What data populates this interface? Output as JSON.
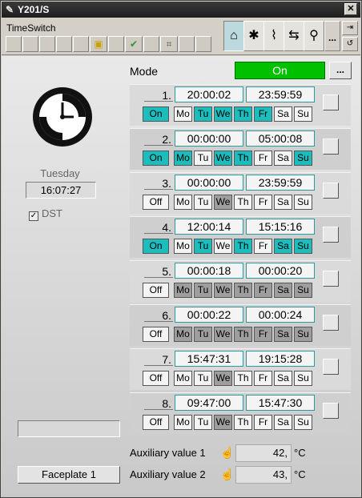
{
  "window": {
    "title": "Y201/S",
    "close_glyph": "✕"
  },
  "toolbar": {
    "app_name": "TimeSwitch",
    "icons": [
      "home-icon",
      "settings-icon",
      "trend-icon",
      "alarm-icon",
      "search-icon"
    ],
    "more_label": "...",
    "side_glyphs": [
      "⇥",
      "↺"
    ]
  },
  "clock": {
    "day": "Tuesday",
    "time": "16:07:27"
  },
  "dst": {
    "label": "DST",
    "checked": true,
    "mark": "✓"
  },
  "mode": {
    "label": "Mode",
    "value": "On",
    "more_label": "..."
  },
  "day_labels": [
    "Mo",
    "Tu",
    "We",
    "Th",
    "Fr",
    "Sa",
    "Su"
  ],
  "slots": [
    {
      "num": "1.",
      "start": "20:00:02",
      "end": "23:59:59",
      "state": "On",
      "days": [
        "off",
        "on",
        "on",
        "on",
        "on",
        "off",
        "off"
      ]
    },
    {
      "num": "2.",
      "start": "00:00:00",
      "end": "05:00:08",
      "state": "On",
      "days": [
        "on",
        "off",
        "on",
        "on",
        "off",
        "off",
        "on"
      ]
    },
    {
      "num": "3.",
      "start": "00:00:00",
      "end": "23:59:59",
      "state": "Off",
      "days": [
        "off",
        "off",
        "dim",
        "off",
        "off",
        "off",
        "off"
      ]
    },
    {
      "num": "4.",
      "start": "12:00:14",
      "end": "15:15:16",
      "state": "On",
      "days": [
        "off",
        "on",
        "off",
        "on",
        "off",
        "on",
        "on"
      ]
    },
    {
      "num": "5.",
      "start": "00:00:18",
      "end": "00:00:20",
      "state": "Off",
      "days": [
        "dim",
        "dim",
        "dim",
        "dim",
        "dim",
        "dim",
        "dim"
      ]
    },
    {
      "num": "6.",
      "start": "00:00:22",
      "end": "00:00:24",
      "state": "Off",
      "days": [
        "dim",
        "dim",
        "dim",
        "dim",
        "dim",
        "dim",
        "dim"
      ]
    },
    {
      "num": "7.",
      "start": "15:47:31",
      "end": "19:15:28",
      "state": "Off",
      "days": [
        "off",
        "off",
        "dim",
        "off",
        "off",
        "off",
        "off"
      ]
    },
    {
      "num": "8.",
      "start": "09:47:00",
      "end": "15:47:30",
      "state": "Off",
      "days": [
        "off",
        "off",
        "dim",
        "off",
        "off",
        "off",
        "off"
      ]
    }
  ],
  "footer": {
    "faceplate_label": "Faceplate 1"
  },
  "aux": [
    {
      "label": "Auxiliary value 1",
      "value": "42,",
      "unit": "°C"
    },
    {
      "label": "Auxiliary value 2",
      "value": "43,",
      "unit": "°C"
    }
  ],
  "colors": {
    "on": "#1bbdbd",
    "mode_on": "#00c000",
    "title_bar": "#2a2a2a"
  }
}
